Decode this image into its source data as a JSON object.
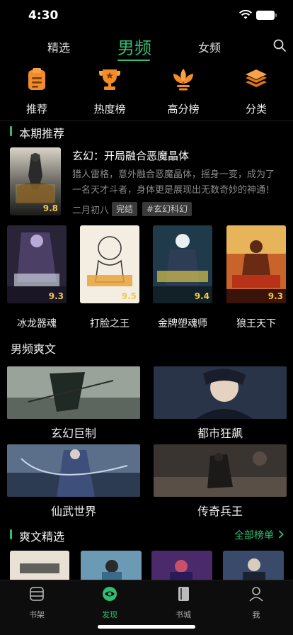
{
  "status": {
    "time": "4:30"
  },
  "top_tabs": [
    {
      "label": "精选"
    },
    {
      "label": "男频"
    },
    {
      "label": "女频"
    }
  ],
  "categories": [
    {
      "label": "推荐",
      "icon": "clipboard-icon"
    },
    {
      "label": "热度榜",
      "icon": "trophy-icon"
    },
    {
      "label": "高分榜",
      "icon": "flower-icon"
    },
    {
      "label": "分类",
      "icon": "layers-icon"
    }
  ],
  "featured_section": {
    "title": "本期推荐",
    "book": {
      "title": "玄幻：开局融合恶魔晶体",
      "description": "猎人雷格，意外融合恶魔晶体，摇身一变，成为了一名天才斗者，身体更是展现出无数奇妙的神通！",
      "author": "二月初八",
      "tags": [
        "完结",
        "#玄幻科幻"
      ],
      "score": "9.8"
    }
  },
  "books": [
    {
      "name": "冰龙器魂",
      "score": "9.3"
    },
    {
      "name": "打脸之王",
      "score": "9.5"
    },
    {
      "name": "金牌塑魂师",
      "score": "9.4"
    },
    {
      "name": "狼王天下",
      "score": "9.3"
    }
  ],
  "genre_section": {
    "title": "男频爽文",
    "genres": [
      {
        "name": "玄幻巨制"
      },
      {
        "name": "都市狂飙"
      },
      {
        "name": "仙武世界"
      },
      {
        "name": "传奇兵王"
      }
    ]
  },
  "picks_section": {
    "title": "爽文精选",
    "link": "全部榜单"
  },
  "bottom_nav": [
    {
      "label": "书架",
      "icon": "bookshelf-icon"
    },
    {
      "label": "发现",
      "icon": "eye-icon"
    },
    {
      "label": "书城",
      "icon": "book-icon"
    },
    {
      "label": "我",
      "icon": "user-icon"
    }
  ],
  "colors": {
    "accent": "#2fbf71",
    "background": "#000000",
    "score": "#f2c94c",
    "icon_orange": "#f28c28"
  }
}
